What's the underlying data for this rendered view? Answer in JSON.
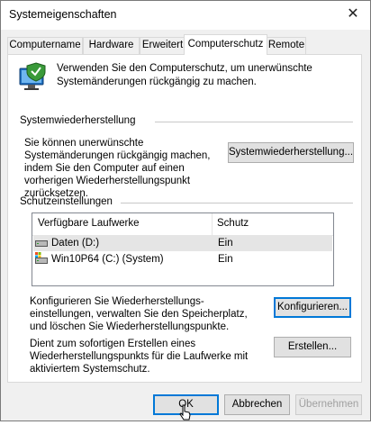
{
  "window": {
    "title": "Systemeigenschaften",
    "close_glyph": "✕"
  },
  "tabs": [
    {
      "label": "Computername",
      "active": false
    },
    {
      "label": "Hardware",
      "active": false
    },
    {
      "label": "Erweitert",
      "active": false
    },
    {
      "label": "Computerschutz",
      "active": true
    },
    {
      "label": "Remote",
      "active": false
    }
  ],
  "intro": {
    "icon": "system-protection-shield-icon",
    "text": "Verwenden Sie den Computerschutz, um unerwünschte Systemänderungen rückgängig zu machen."
  },
  "restore": {
    "group_title": "Systemwiederherstellung",
    "description": "Sie können unerwünschte Systemänderungen rückgängig machen, indem Sie den Computer auf einen vorherigen Wiederherstellungspunkt zurücksetzen.",
    "button_label": "Systemwiederherstellung..."
  },
  "protection": {
    "group_title": "Schutzeinstellungen",
    "columns": [
      "Verfügbare Laufwerke",
      "Schutz"
    ],
    "drives": [
      {
        "name": "Daten (D:)",
        "status": "Ein",
        "icon": "drive-icon",
        "selected": true
      },
      {
        "name": "Win10P64 (C:) (System)",
        "status": "Ein",
        "icon": "system-drive-icon",
        "selected": false
      }
    ],
    "configure_text": "Konfigurieren Sie Wiederherstellungs-einstellungen, verwalten Sie den Speicherplatz, und löschen Sie Wiederherstellungspunkte.",
    "configure_button": "Konfigurieren...",
    "create_text": "Dient zum sofortigen Erstellen eines Wiederherstellungspunkts für die Laufwerke mit aktiviertem Systemschutz.",
    "create_button": "Erstellen..."
  },
  "footer": {
    "ok": "OK",
    "cancel": "Abbrechen",
    "apply": "Übernehmen"
  },
  "colors": {
    "accent": "#0078d7",
    "dialog_bg": "#f0f0f0",
    "panel_bg": "#ffffff"
  }
}
